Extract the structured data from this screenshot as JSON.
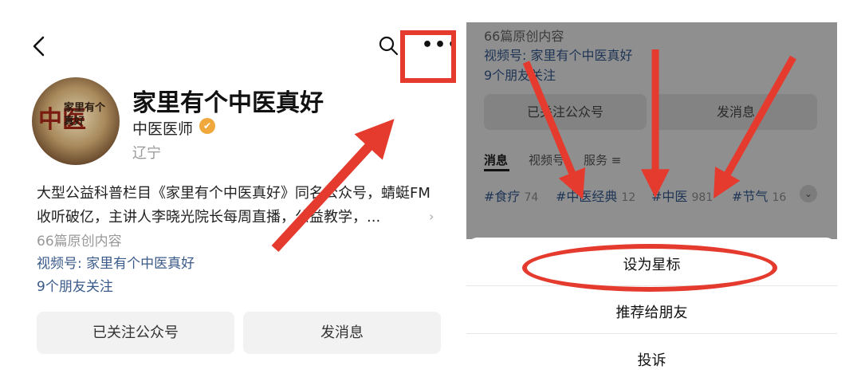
{
  "left": {
    "account_name": "家里有个中医真好",
    "org_label": "中医医师",
    "verified_mark": "✔",
    "region": "辽宁",
    "description": "大型公益科普栏目《家里有个中医真好》同名公众号，蜻蜓FM收听破亿，主讲人李晓光院长每周直播，公益教学，...",
    "original_count": "66篇原创内容",
    "video_account": "视频号: 家里有个中医真好",
    "friends_follow": "9个朋友关注",
    "follow_button": "已关注公众号",
    "message_button": "发消息",
    "avatar_text_big": "中医",
    "avatar_text_small": "家里有个\n真好",
    "more_glyph": "•••",
    "back_glyph": "<"
  },
  "right": {
    "original_count": "66篇原创内容",
    "video_account": "视频号: 家里有个中医真好",
    "friends_follow": "9个朋友关注",
    "follow_button": "已关注公众号",
    "message_button": "发消息",
    "tabs": [
      "消息",
      "视频号",
      "服务 ≡"
    ],
    "tags": [
      {
        "label": "#食疗",
        "count": "74"
      },
      {
        "label": "#中医经典",
        "count": "12"
      },
      {
        "label": "#中医",
        "count": "981"
      },
      {
        "label": "#节气",
        "count": "16"
      }
    ],
    "expand_glyph": "⌄",
    "sheet_options": [
      "设为星标",
      "推荐给朋友",
      "投诉"
    ]
  },
  "icons": [
    "back-icon",
    "search-icon",
    "more-icon",
    "verified-icon",
    "expand-icon"
  ],
  "colors": {
    "annotation_red": "#e53b2f",
    "verified_orange": "#f0a83c",
    "link_blue": "#3a5a8a"
  }
}
